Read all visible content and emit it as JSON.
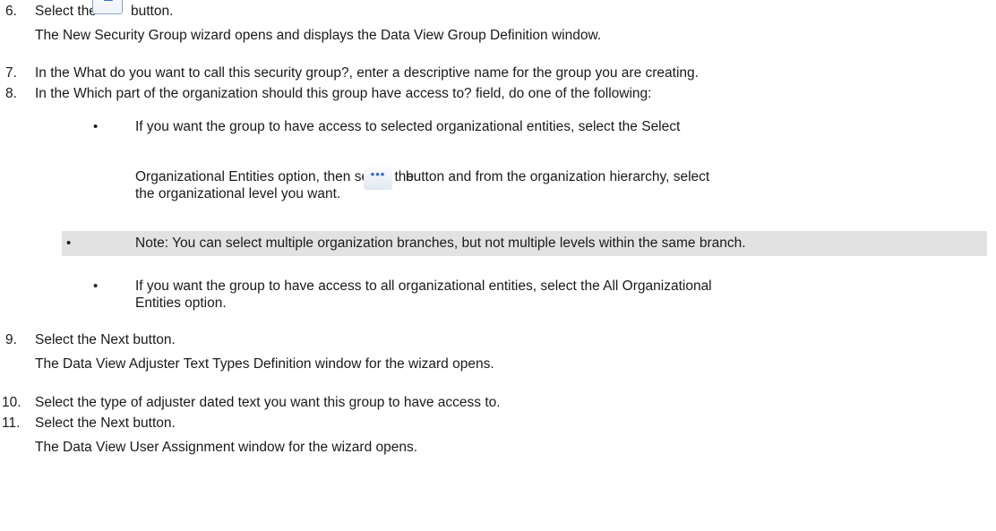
{
  "steps": {
    "s6": {
      "number": "6.",
      "before_icon": "Select the",
      "after_icon": "button.",
      "icon": "new-security-group-icon",
      "result": "The New Security Group wizard opens and displays the Data View Group Definition window."
    },
    "s7": {
      "number": "7.",
      "text": "In the What do you want to call this security group?, enter a descriptive name for the group you are creating."
    },
    "s8": {
      "number": "8.",
      "text": "In the Which part of the organization should this group have access to? field, do one of the following:",
      "bullet1_line1": "If you want the group to have access to selected organizational entities, select the Select",
      "bullet1_line2_before": "Organizational Entities option, then select the",
      "bullet1_line2_after": "button and from the organization hierarchy, select",
      "bullet1_line3": "the organizational level you want.",
      "ellipsis_icon": "ellipsis-button-icon",
      "note": "Note: You can select multiple organization branches, but not multiple levels within the same branch.",
      "bullet2_line1": "If you want the group to have access to all organizational entities, select the All Organizational",
      "bullet2_line2": "Entities option."
    },
    "s9": {
      "number": "9.",
      "text": "Select the Next button.",
      "result": "The Data View Adjuster Text Types Definition window for the wizard opens."
    },
    "s10": {
      "number": "10.",
      "text": "Select the type of adjuster dated text you want this group to have access to."
    },
    "s11": {
      "number": "11.",
      "text": "Select the Next button.",
      "result": "The Data View User Assignment window for the wizard opens."
    }
  },
  "bullet_char": "•"
}
